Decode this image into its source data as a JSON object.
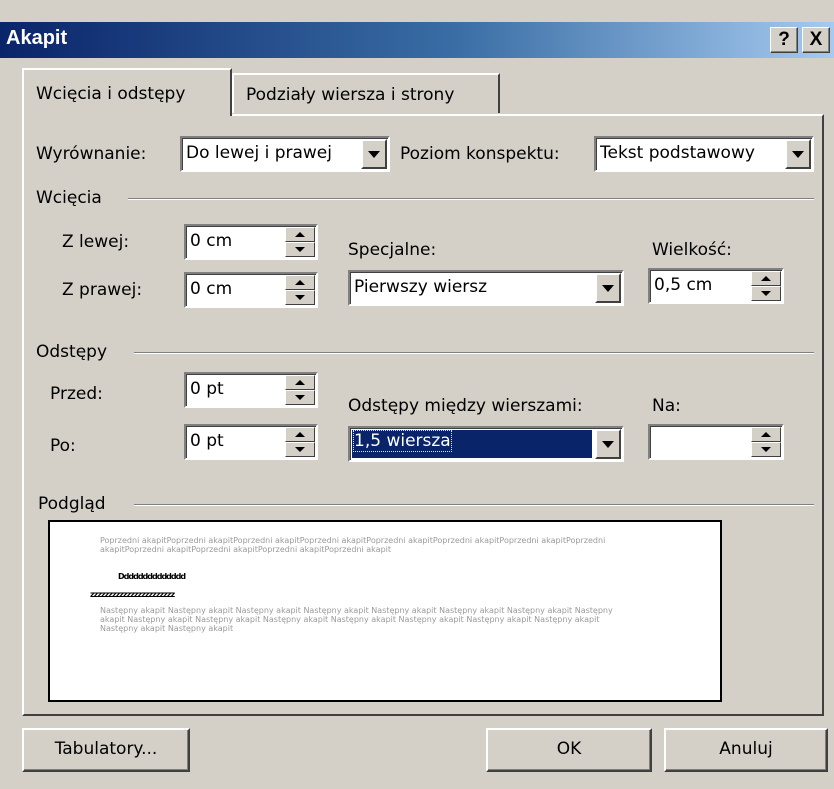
{
  "window": {
    "title": "Akapit",
    "help_button": "?",
    "close_button": "X",
    "colors": {
      "titlebar_start": "#0a246a",
      "titlebar_end": "#a6caf0",
      "face": "#d4d0c8",
      "selection": "#0a246a"
    }
  },
  "tabs": [
    {
      "label": "Wcięcia i odstępy",
      "active": true
    },
    {
      "label": "Podziały wiersza i strony",
      "active": false
    }
  ],
  "general": {
    "alignment_label": "Wyrównanie:",
    "alignment_value": "Do lewej i prawej",
    "outline_label": "Poziom konspektu:",
    "outline_value": "Tekst podstawowy"
  },
  "indentation": {
    "group_label": "Wcięcia",
    "left_label": "Z lewej:",
    "left_value": "0 cm",
    "right_label": "Z prawej:",
    "right_value": "0 cm",
    "special_label": "Specjalne:",
    "special_value": "Pierwszy wiersz",
    "by_label": "Wielkość:",
    "by_value": "0,5 cm"
  },
  "spacing": {
    "group_label": "Odstępy",
    "before_label": "Przed:",
    "before_value": "0 pt",
    "after_label": "Po:",
    "after_value": "0 pt",
    "line_label": "Odstępy między wierszami:",
    "line_value": "1,5 wiersza",
    "at_label": "Na:",
    "at_value": ""
  },
  "preview": {
    "group_label": "Podgląd",
    "previous_text": "Poprzedni akapitPoprzedni akapitPoprzedni akapitPoprzedni akapitPoprzedni akapitPoprzedni akapitPoprzedni akapitPoprzedni akapitPoprzedni akapitPoprzedni akapitPoprzedni akapitPoprzedni akapit",
    "current_line1": "Dddddddddddddd",
    "current_line2": "zzzzzzzzzzzzzzzzzzzzzzz",
    "next_text": "Następny akapit Następny akapit Następny akapit Następny akapit Następny akapit Następny akapit Następny akapit Następny akapit Następny akapit Następny akapit Następny akapit Następny akapit Następny akapit Następny akapit Następny akapit Następny akapit Następny akapit"
  },
  "buttons": {
    "tabs": "Tabulatory...",
    "ok": "OK",
    "cancel": "Anuluj"
  }
}
